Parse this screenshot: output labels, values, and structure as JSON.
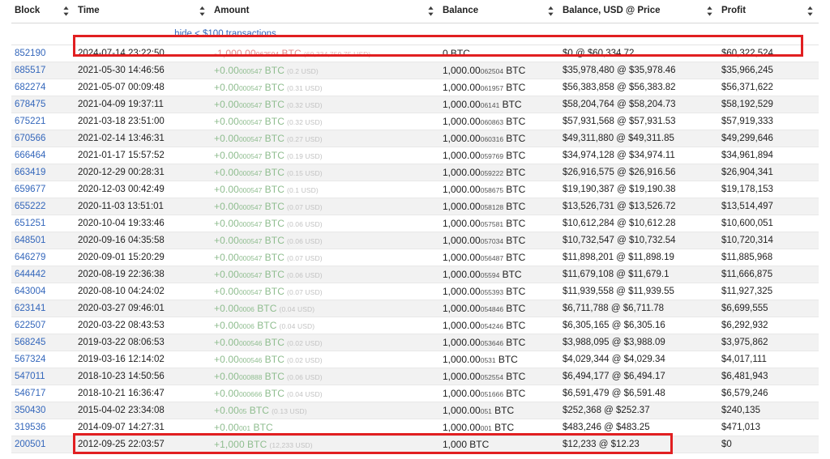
{
  "table": {
    "columns": [
      {
        "label": "Block",
        "sort_icon": "sort-updown-icon"
      },
      {
        "label": "Time",
        "sort_icon": "sort-updown-icon"
      },
      {
        "label": "Amount",
        "sort_icon": "sort-updown-icon"
      },
      {
        "label": "Balance",
        "sort_icon": "sort-updown-icon"
      },
      {
        "label": "Balance, USD @ Price",
        "sort_icon": "sort-updown-icon"
      },
      {
        "label": "Profit",
        "sort_icon": "sort-updown-icon"
      }
    ],
    "notice": {
      "hide_link": "hide < $100 transactions"
    },
    "rows": [
      {
        "block": "852190",
        "time": "2024-07-14 23:22:50",
        "amount": {
          "sign": "neg",
          "main": "-1,000.00",
          "sub": "062504",
          "unit": "BTC",
          "usd": "(60,334,759.75 USD)"
        },
        "balance": {
          "main": "0",
          "sub": "",
          "unit": "BTC"
        },
        "usd": "$0 @ $60,334.72",
        "profit": "$60,322,524",
        "highlighted": true
      },
      {
        "block": "685517",
        "time": "2021-05-30 14:46:56",
        "amount": {
          "sign": "pos",
          "main": "+0.00",
          "sub": "000547",
          "unit": "BTC",
          "usd": "(0.2 USD)"
        },
        "balance": {
          "main": "1,000.00",
          "sub": "062504",
          "unit": "BTC"
        },
        "usd": "$35,978,480 @ $35,978.46",
        "profit": "$35,966,245",
        "highlighted": false
      },
      {
        "block": "682274",
        "time": "2021-05-07 00:09:48",
        "amount": {
          "sign": "pos",
          "main": "+0.00",
          "sub": "000547",
          "unit": "BTC",
          "usd": "(0.31 USD)"
        },
        "balance": {
          "main": "1,000.00",
          "sub": "061957",
          "unit": "BTC"
        },
        "usd": "$56,383,858 @ $56,383.82",
        "profit": "$56,371,622",
        "highlighted": false
      },
      {
        "block": "678475",
        "time": "2021-04-09 19:37:11",
        "amount": {
          "sign": "pos",
          "main": "+0.00",
          "sub": "000547",
          "unit": "BTC",
          "usd": "(0.32 USD)"
        },
        "balance": {
          "main": "1,000.00",
          "sub": "06141",
          "unit": "BTC"
        },
        "usd": "$58,204,764 @ $58,204.73",
        "profit": "$58,192,529",
        "highlighted": false
      },
      {
        "block": "675221",
        "time": "2021-03-18 23:51:00",
        "amount": {
          "sign": "pos",
          "main": "+0.00",
          "sub": "000547",
          "unit": "BTC",
          "usd": "(0.32 USD)"
        },
        "balance": {
          "main": "1,000.00",
          "sub": "060863",
          "unit": "BTC"
        },
        "usd": "$57,931,568 @ $57,931.53",
        "profit": "$57,919,333",
        "highlighted": false
      },
      {
        "block": "670566",
        "time": "2021-02-14 13:46:31",
        "amount": {
          "sign": "pos",
          "main": "+0.00",
          "sub": "000547",
          "unit": "BTC",
          "usd": "(0.27 USD)"
        },
        "balance": {
          "main": "1,000.00",
          "sub": "060316",
          "unit": "BTC"
        },
        "usd": "$49,311,880 @ $49,311.85",
        "profit": "$49,299,646",
        "highlighted": false
      },
      {
        "block": "666464",
        "time": "2021-01-17 15:57:52",
        "amount": {
          "sign": "pos",
          "main": "+0.00",
          "sub": "000547",
          "unit": "BTC",
          "usd": "(0.19 USD)"
        },
        "balance": {
          "main": "1,000.00",
          "sub": "059769",
          "unit": "BTC"
        },
        "usd": "$34,974,128 @ $34,974.11",
        "profit": "$34,961,894",
        "highlighted": false
      },
      {
        "block": "663419",
        "time": "2020-12-29 00:28:31",
        "amount": {
          "sign": "pos",
          "main": "+0.00",
          "sub": "000547",
          "unit": "BTC",
          "usd": "(0.15 USD)"
        },
        "balance": {
          "main": "1,000.00",
          "sub": "059222",
          "unit": "BTC"
        },
        "usd": "$26,916,575 @ $26,916.56",
        "profit": "$26,904,341",
        "highlighted": false
      },
      {
        "block": "659677",
        "time": "2020-12-03 00:42:49",
        "amount": {
          "sign": "pos",
          "main": "+0.00",
          "sub": "000547",
          "unit": "BTC",
          "usd": "(0.1 USD)"
        },
        "balance": {
          "main": "1,000.00",
          "sub": "058675",
          "unit": "BTC"
        },
        "usd": "$19,190,387 @ $19,190.38",
        "profit": "$19,178,153",
        "highlighted": false
      },
      {
        "block": "655222",
        "time": "2020-11-03 13:51:01",
        "amount": {
          "sign": "pos",
          "main": "+0.00",
          "sub": "000547",
          "unit": "BTC",
          "usd": "(0.07 USD)"
        },
        "balance": {
          "main": "1,000.00",
          "sub": "058128",
          "unit": "BTC"
        },
        "usd": "$13,526,731 @ $13,526.72",
        "profit": "$13,514,497",
        "highlighted": false
      },
      {
        "block": "651251",
        "time": "2020-10-04 19:33:46",
        "amount": {
          "sign": "pos",
          "main": "+0.00",
          "sub": "000547",
          "unit": "BTC",
          "usd": "(0.06 USD)"
        },
        "balance": {
          "main": "1,000.00",
          "sub": "057581",
          "unit": "BTC"
        },
        "usd": "$10,612,284 @ $10,612.28",
        "profit": "$10,600,051",
        "highlighted": false
      },
      {
        "block": "648501",
        "time": "2020-09-16 04:35:58",
        "amount": {
          "sign": "pos",
          "main": "+0.00",
          "sub": "000547",
          "unit": "BTC",
          "usd": "(0.06 USD)"
        },
        "balance": {
          "main": "1,000.00",
          "sub": "057034",
          "unit": "BTC"
        },
        "usd": "$10,732,547 @ $10,732.54",
        "profit": "$10,720,314",
        "highlighted": false
      },
      {
        "block": "646279",
        "time": "2020-09-01 15:20:29",
        "amount": {
          "sign": "pos",
          "main": "+0.00",
          "sub": "000547",
          "unit": "BTC",
          "usd": "(0.07 USD)"
        },
        "balance": {
          "main": "1,000.00",
          "sub": "056487",
          "unit": "BTC"
        },
        "usd": "$11,898,201 @ $11,898.19",
        "profit": "$11,885,968",
        "highlighted": false
      },
      {
        "block": "644442",
        "time": "2020-08-19 22:36:38",
        "amount": {
          "sign": "pos",
          "main": "+0.00",
          "sub": "000547",
          "unit": "BTC",
          "usd": "(0.06 USD)"
        },
        "balance": {
          "main": "1,000.00",
          "sub": "05594",
          "unit": "BTC"
        },
        "usd": "$11,679,108 @ $11,679.1",
        "profit": "$11,666,875",
        "highlighted": false
      },
      {
        "block": "643004",
        "time": "2020-08-10 04:24:02",
        "amount": {
          "sign": "pos",
          "main": "+0.00",
          "sub": "000547",
          "unit": "BTC",
          "usd": "(0.07 USD)"
        },
        "balance": {
          "main": "1,000.00",
          "sub": "055393",
          "unit": "BTC"
        },
        "usd": "$11,939,558 @ $11,939.55",
        "profit": "$11,927,325",
        "highlighted": false
      },
      {
        "block": "623141",
        "time": "2020-03-27 09:46:01",
        "amount": {
          "sign": "pos",
          "main": "+0.00",
          "sub": "0006",
          "unit": "BTC",
          "usd": "(0.04 USD)"
        },
        "balance": {
          "main": "1,000.00",
          "sub": "054846",
          "unit": "BTC"
        },
        "usd": "$6,711,788 @ $6,711.78",
        "profit": "$6,699,555",
        "highlighted": false
      },
      {
        "block": "622507",
        "time": "2020-03-22 08:43:53",
        "amount": {
          "sign": "pos",
          "main": "+0.00",
          "sub": "0006",
          "unit": "BTC",
          "usd": "(0.04 USD)"
        },
        "balance": {
          "main": "1,000.00",
          "sub": "054246",
          "unit": "BTC"
        },
        "usd": "$6,305,165 @ $6,305.16",
        "profit": "$6,292,932",
        "highlighted": false
      },
      {
        "block": "568245",
        "time": "2019-03-22 08:06:53",
        "amount": {
          "sign": "pos",
          "main": "+0.00",
          "sub": "000546",
          "unit": "BTC",
          "usd": "(0.02 USD)"
        },
        "balance": {
          "main": "1,000.00",
          "sub": "053646",
          "unit": "BTC"
        },
        "usd": "$3,988,095 @ $3,988.09",
        "profit": "$3,975,862",
        "highlighted": false
      },
      {
        "block": "567324",
        "time": "2019-03-16 12:14:02",
        "amount": {
          "sign": "pos",
          "main": "+0.00",
          "sub": "000546",
          "unit": "BTC",
          "usd": "(0.02 USD)"
        },
        "balance": {
          "main": "1,000.00",
          "sub": "0531",
          "unit": "BTC"
        },
        "usd": "$4,029,344 @ $4,029.34",
        "profit": "$4,017,111",
        "highlighted": false
      },
      {
        "block": "547011",
        "time": "2018-10-23 14:50:56",
        "amount": {
          "sign": "pos",
          "main": "+0.00",
          "sub": "000888",
          "unit": "BTC",
          "usd": "(0.06 USD)"
        },
        "balance": {
          "main": "1,000.00",
          "sub": "052554",
          "unit": "BTC"
        },
        "usd": "$6,494,177 @ $6,494.17",
        "profit": "$6,481,943",
        "highlighted": false
      },
      {
        "block": "546717",
        "time": "2018-10-21 16:36:47",
        "amount": {
          "sign": "pos",
          "main": "+0.00",
          "sub": "000666",
          "unit": "BTC",
          "usd": "(0.04 USD)"
        },
        "balance": {
          "main": "1,000.00",
          "sub": "051666",
          "unit": "BTC"
        },
        "usd": "$6,591,479 @ $6,591.48",
        "profit": "$6,579,246",
        "highlighted": false
      },
      {
        "block": "350430",
        "time": "2015-04-02 23:34:08",
        "amount": {
          "sign": "pos",
          "main": "+0.00",
          "sub": "05",
          "unit": "BTC",
          "usd": "(0.13 USD)"
        },
        "balance": {
          "main": "1,000.00",
          "sub": "051",
          "unit": "BTC"
        },
        "usd": "$252,368 @ $252.37",
        "profit": "$240,135",
        "highlighted": false
      },
      {
        "block": "319536",
        "time": "2014-09-07 14:27:31",
        "amount": {
          "sign": "pos",
          "main": "+0.00",
          "sub": "001",
          "unit": "BTC",
          "usd": ""
        },
        "balance": {
          "main": "1,000.00",
          "sub": "001",
          "unit": "BTC"
        },
        "usd": "$483,246 @ $483.25",
        "profit": "$471,013",
        "highlighted": false
      },
      {
        "block": "200501",
        "time": "2012-09-25 22:03:57",
        "amount": {
          "sign": "pos",
          "main": "+1,000",
          "sub": "",
          "unit": "BTC",
          "usd": "(12,233 USD)"
        },
        "balance": {
          "main": "1,000",
          "sub": "",
          "unit": "BTC"
        },
        "usd": "$12,233 @ $12.23",
        "profit": "$0",
        "highlighted": true
      }
    ]
  },
  "annotations": {
    "highlight_color": "#e11f21",
    "boxes": [
      {
        "name": "top-row-highlight"
      },
      {
        "name": "bottom-row-highlight"
      }
    ]
  }
}
